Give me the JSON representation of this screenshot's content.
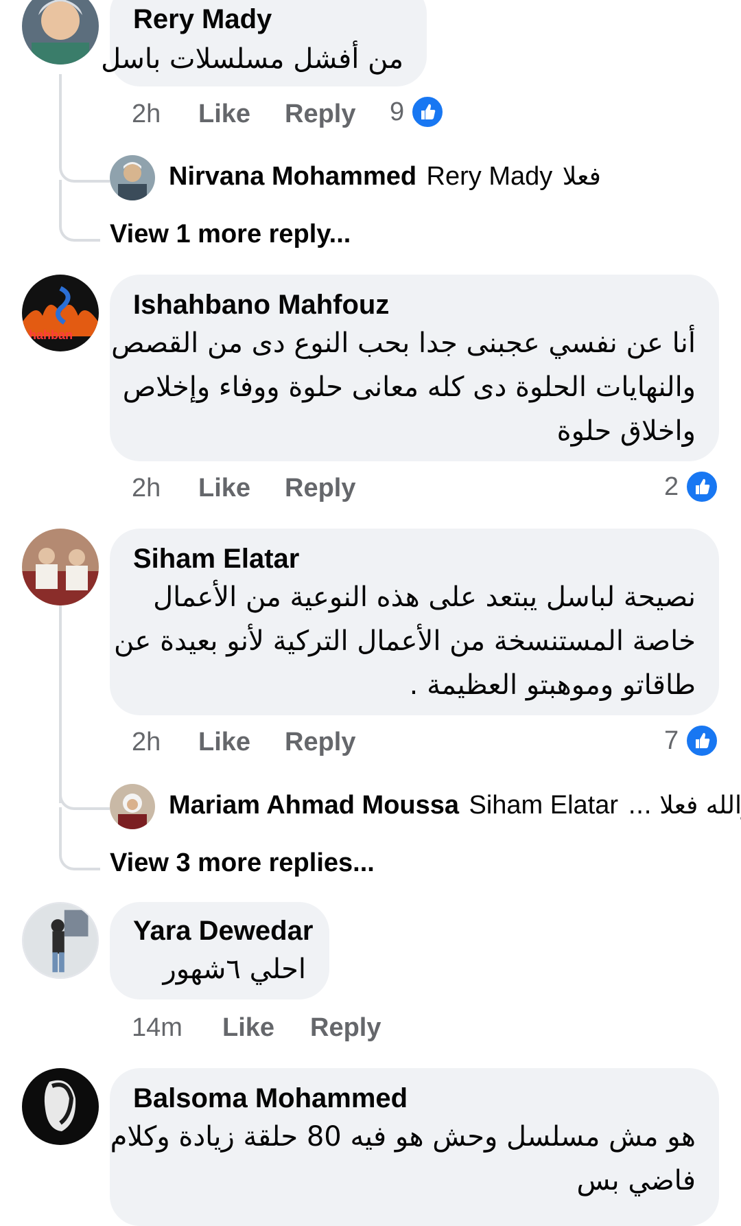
{
  "comments": [
    {
      "author": "Rery Mady",
      "text_lines": [
        "من أفشل مسلسلات باسل"
      ],
      "time": "2h",
      "like_label": "Like",
      "reply_label": "Reply",
      "likes": "9",
      "reply_preview": {
        "author": "Nirvana Mohammed",
        "mention": "Rery Mady",
        "text": "فعلا"
      },
      "view_more": "View 1 more reply..."
    },
    {
      "author": "Ishahbano Mahfouz",
      "text_lines": [
        "أنا عن نفسي عجبنى جدا بحب النوع دى من القصص",
        "والنهايات الحلوة دى كله معانى حلوة ووفاء وإخلاص",
        "واخلاق حلوة"
      ],
      "time": "2h",
      "like_label": "Like",
      "reply_label": "Reply",
      "likes": "2"
    },
    {
      "author": "Siham Elatar",
      "text_lines": [
        "نصيحة لباسل يبتعد على هذه النوعية من الأعمال",
        "خاصة المستنسخة من الأعمال التركية لأنو بعيدة عن",
        "طاقاتو وموهبتو العظيمة ."
      ],
      "time": "2h",
      "like_label": "Like",
      "reply_label": "Reply",
      "likes": "7",
      "reply_preview": {
        "author": "Mariam Ahmad Moussa",
        "mention": "Siham Elatar",
        "text": "والله فعلا ..."
      },
      "view_more": "View 3 more replies..."
    },
    {
      "author": "Yara Dewedar",
      "text_lines": [
        "احلي ٦شهور"
      ],
      "time": "14m",
      "like_label": "Like",
      "reply_label": "Reply"
    },
    {
      "author": "Balsoma Mohammed",
      "text_lines": [
        "هو مش مسلسل وحش هو فيه 80 حلقة زيادة وكلام",
        "فاضي بس"
      ]
    }
  ],
  "avatar_badge_text": "hahban",
  "colors": {
    "bubble": "#f0f2f5",
    "secondary_text": "#65676b",
    "like_blue": "#1877f2",
    "thread_line": "#dadde1"
  },
  "icons": {
    "like": "thumbs-up-icon"
  }
}
